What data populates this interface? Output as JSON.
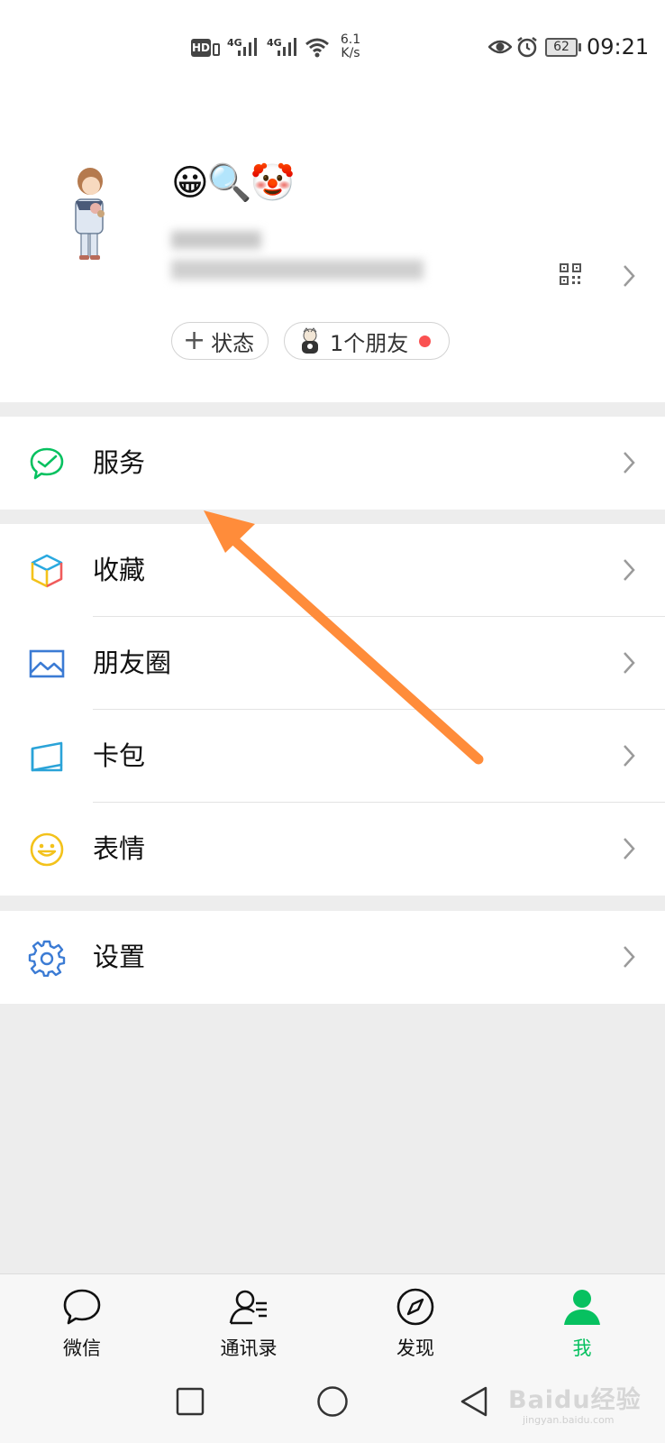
{
  "status_bar": {
    "hd": "HD",
    "sim1": "4G",
    "sim2": "4G",
    "speed_value": "6.1",
    "speed_unit": "K/s",
    "battery": "62",
    "time": "09:21"
  },
  "profile": {
    "emojis": "😀🔍🤡",
    "status_button_label": "状态",
    "friends_label": "1个朋友"
  },
  "menu": {
    "services": "服务",
    "favorites": "收藏",
    "moments": "朋友圈",
    "cards": "卡包",
    "stickers": "表情",
    "settings": "设置"
  },
  "tabs": {
    "chats": "微信",
    "contacts": "通讯录",
    "discover": "发现",
    "me": "我"
  },
  "colors": {
    "brand_green": "#07c160",
    "annotation_arrow": "#ff8c3a",
    "notification_dot": "#fa5151"
  },
  "watermark": {
    "text": "Baidu经验",
    "url": "jingyan.baidu.com"
  }
}
